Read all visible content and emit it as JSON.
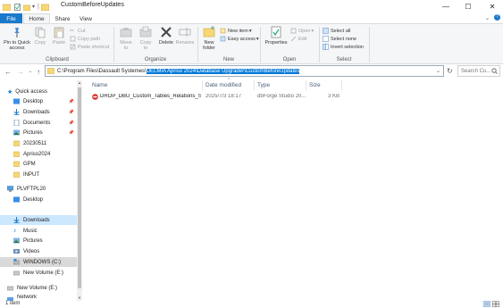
{
  "window": {
    "title": "CustomBeforeUpdates",
    "minimize": "—",
    "maximize": "☐",
    "close": "✕"
  },
  "tabs": {
    "file": "File",
    "home": "Home",
    "share": "Share",
    "view": "View"
  },
  "ribbon": {
    "clipboard": {
      "label": "Clipboard",
      "pin": "Pin to Quick\naccess",
      "copy": "Copy",
      "paste": "Paste",
      "cut": "Cut",
      "copy_path": "Copy path",
      "paste_shortcut": "Paste shortcut"
    },
    "organize": {
      "label": "Organize",
      "move_to": "Move\nto",
      "copy_to": "Copy\nto",
      "delete": "Delete",
      "rename": "Rename"
    },
    "new": {
      "label": "New",
      "new_folder": "New\nfolder",
      "new_item": "New item",
      "easy_access": "Easy access"
    },
    "open": {
      "label": "Open",
      "properties": "Properties",
      "open": "Open",
      "edit": "Edit"
    },
    "select": {
      "label": "Select",
      "select_all": "Select all",
      "select_none": "Select none",
      "invert": "Invert selection"
    }
  },
  "address": {
    "prefix": "C:\\Program Files\\Dassault Systemes\\",
    "selected": "DELMIA Apriso 2024\\Database Upgrader\\CustomBeforeUpdates",
    "search_placeholder": "Search Cu..."
  },
  "nav": {
    "quick_access": "Quick access",
    "quick_items": [
      {
        "label": "Desktop"
      },
      {
        "label": "Downloads"
      },
      {
        "label": "Documents"
      },
      {
        "label": "Pictures"
      },
      {
        "label": "20230511"
      },
      {
        "label": "Apriso2024"
      },
      {
        "label": "GPM"
      },
      {
        "label": "INPUT"
      }
    ],
    "pc": "PLVFTPL20",
    "pc_items": [
      {
        "label": "Desktop"
      },
      {
        "label": "Downloads"
      },
      {
        "label": "Music"
      },
      {
        "label": "Pictures"
      },
      {
        "label": "Videos"
      },
      {
        "label": "WINDOWS (C:)"
      },
      {
        "label": "New Volume (E:)"
      }
    ],
    "volume_e": "New Volume (E:)",
    "network": "Network"
  },
  "columns": {
    "name": "Name",
    "date": "Date modified",
    "type": "Type",
    "size": "Size"
  },
  "files": [
    {
      "name": "DROP_DBU_Custom_Tables_Relations_Sc...",
      "date": "2025/7/3 18:17",
      "type": "dbForge Studio 20...",
      "size": "3 KB"
    }
  ],
  "status": {
    "count": "1 item"
  },
  "colors": {
    "accent": "#1979ca",
    "selection": "#cce8ff",
    "address_selection": "#0078d7",
    "folder": "#f8d775"
  }
}
